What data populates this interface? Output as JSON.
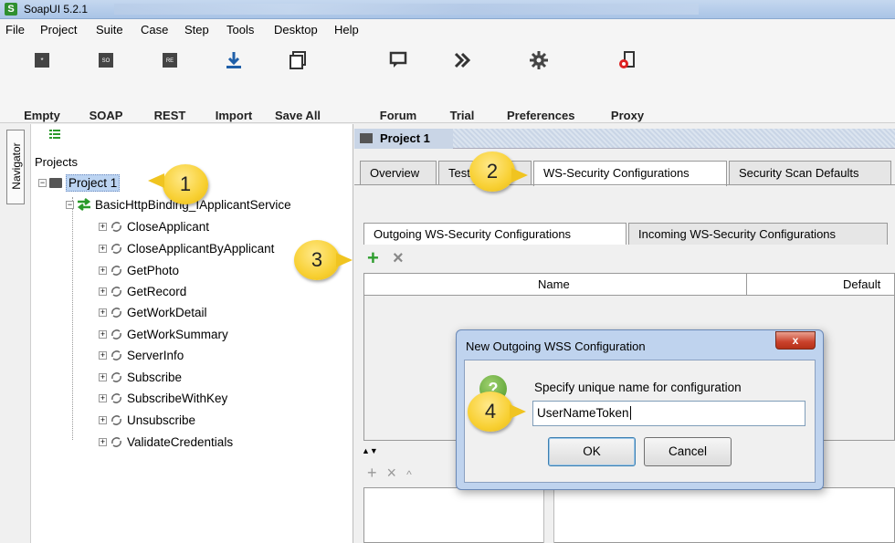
{
  "window": {
    "title": "SoapUI 5.2.1",
    "app_logo": "S"
  },
  "menu": [
    "File",
    "Project",
    "Suite",
    "Case",
    "Step",
    "Tools",
    "Desktop",
    "Help"
  ],
  "toolbar": [
    {
      "label": "Empty",
      "icon": "empty-project-icon"
    },
    {
      "label": "SOAP",
      "icon": "soap-project-icon"
    },
    {
      "label": "REST",
      "icon": "rest-project-icon"
    },
    {
      "label": "Import",
      "icon": "import-icon"
    },
    {
      "label": "Save All",
      "icon": "save-all-icon"
    },
    {
      "label": "Forum",
      "icon": "forum-icon"
    },
    {
      "label": "Trial",
      "icon": "trial-icon"
    },
    {
      "label": "Preferences",
      "icon": "gear-icon"
    },
    {
      "label": "Proxy",
      "icon": "proxy-icon"
    }
  ],
  "navigator": {
    "tab_label": "Navigator",
    "root_label": "Projects"
  },
  "tree": {
    "project": "Project 1",
    "interface": "BasicHttpBinding_IApplicantService",
    "operations": [
      "CloseApplicant",
      "CloseApplicantByApplicant",
      "GetPhoto",
      "GetRecord",
      "GetWorkDetail",
      "GetWorkSummary",
      "ServerInfo",
      "Subscribe",
      "SubscribeWithKey",
      "Unsubscribe",
      "ValidateCredentials"
    ]
  },
  "editor": {
    "title": "Project 1",
    "tabs": [
      "Overview",
      "TestSuites",
      "WS-Security Configurations",
      "Security Scan Defaults"
    ],
    "active_tab": "WS-Security Configurations",
    "subtabs": [
      "Outgoing WS-Security Configurations",
      "Incoming WS-Security Configurations"
    ],
    "table_headers": [
      "Name",
      "Default"
    ]
  },
  "dialog": {
    "title": "New Outgoing WSS Configuration",
    "close_label": "x",
    "prompt": "Specify unique name for configuration",
    "value": "UserNameToken",
    "ok": "OK",
    "cancel": "Cancel"
  },
  "callouts": [
    "1",
    "2",
    "3",
    "4"
  ],
  "colors": {
    "accent_green": "#2f9e2f",
    "callout_yellow": "#f8d033",
    "selection": "#bcd4f2"
  }
}
